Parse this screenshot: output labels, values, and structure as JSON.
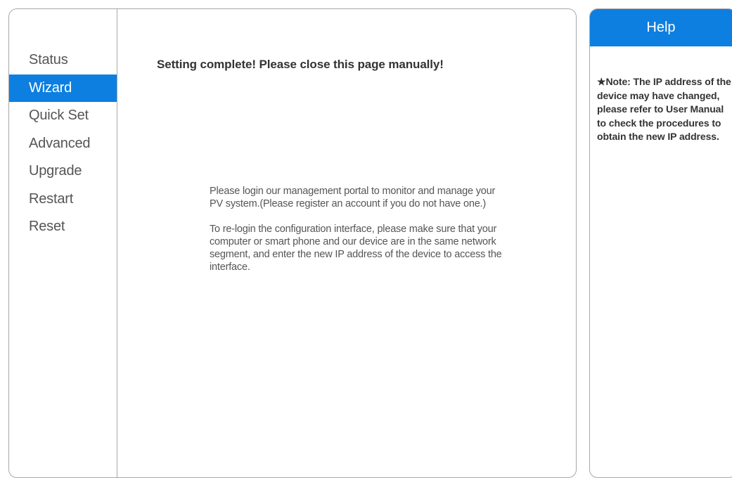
{
  "sidebar": {
    "items": [
      {
        "label": "Status"
      },
      {
        "label": "Wizard",
        "active": true
      },
      {
        "label": "Quick Set"
      },
      {
        "label": "Advanced"
      },
      {
        "label": "Upgrade"
      },
      {
        "label": "Restart"
      },
      {
        "label": "Reset"
      }
    ]
  },
  "main": {
    "complete_message": "Setting complete! Please close this page manually!",
    "paragraphs": [
      "Please login our management portal to monitor and manage your PV system.(Please register an account if you do not have one.)",
      "To re-login the configuration interface, please make sure that your computer or smart phone and our device are in the same network segment, and enter the new IP address of the device to access the interface."
    ]
  },
  "help": {
    "title": "Help",
    "note": "★Note: The IP address of the device may have changed, please refer to User Manual to check the procedures to obtain the new IP address."
  },
  "colors": {
    "accent": "#0d7fe0",
    "border": "#a8a8a8",
    "nav_text": "#555555"
  }
}
